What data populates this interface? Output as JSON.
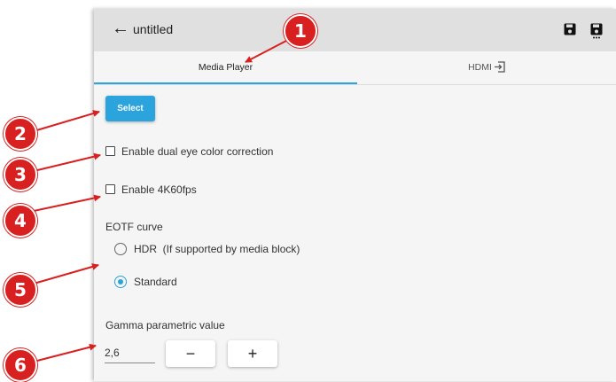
{
  "appbar": {
    "back_icon": "arrow-left-icon",
    "title": "untitled",
    "save_icon": "save-icon",
    "save_as_icon": "save-as-icon"
  },
  "tabs": [
    {
      "label": "Media Player",
      "active": true
    },
    {
      "label": "HDMI",
      "icon": "input-icon",
      "active": false
    }
  ],
  "select_button": {
    "label": "Select"
  },
  "checkboxes": [
    {
      "label": "Enable dual eye color correction",
      "checked": false
    },
    {
      "label": "Enable 4K60fps",
      "checked": false
    }
  ],
  "eotf": {
    "label": "EOTF curve",
    "options": [
      {
        "label": "HDR  (If supported by media block)",
        "selected": false
      },
      {
        "label": "Standard",
        "selected": true
      }
    ]
  },
  "gamma": {
    "label": "Gamma parametric value",
    "value": "2,6",
    "minus_label": "−",
    "plus_label": "+"
  },
  "callouts": [
    "1",
    "2",
    "3",
    "4",
    "5",
    "6"
  ],
  "colors": {
    "accent": "#2ba3dc",
    "callout": "#d82020",
    "appbar": "#e0e0e0"
  }
}
